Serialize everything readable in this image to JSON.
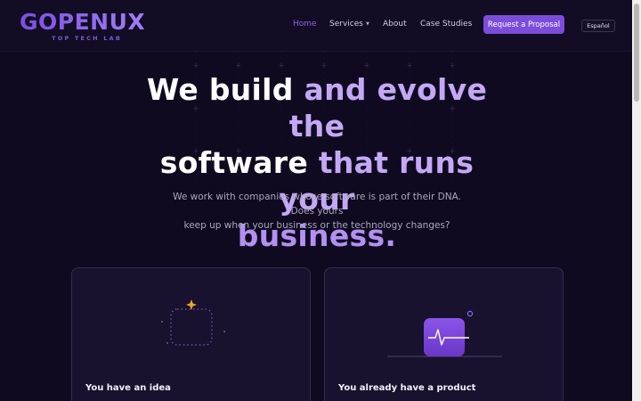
{
  "brand": {
    "name": "GOPENUX",
    "tagline": "TOP TECH LAB",
    "accent": "#7c4dda"
  },
  "nav": {
    "items": [
      {
        "label": "Home",
        "active": true
      },
      {
        "label": "Services",
        "active": false,
        "has_dropdown": true
      },
      {
        "label": "About",
        "active": false
      },
      {
        "label": "Case Studies",
        "active": false
      }
    ],
    "cta_label": "Request a Proposal",
    "language_label": "Español"
  },
  "hero": {
    "title": {
      "line1_a": "We build ",
      "line1_b": "and evolve the",
      "line2_a": "software ",
      "line2_b": "that runs your",
      "line3": "business."
    },
    "subtitle_line1": "We work with companies whose software is part of their DNA. Does yours",
    "subtitle_line2": "keep up when your business or the technology changes?"
  },
  "cards": [
    {
      "title": "You have an idea",
      "icon": "sparkle-idea-icon"
    },
    {
      "title": "You already have a product",
      "icon": "heartbeat-product-icon"
    }
  ]
}
